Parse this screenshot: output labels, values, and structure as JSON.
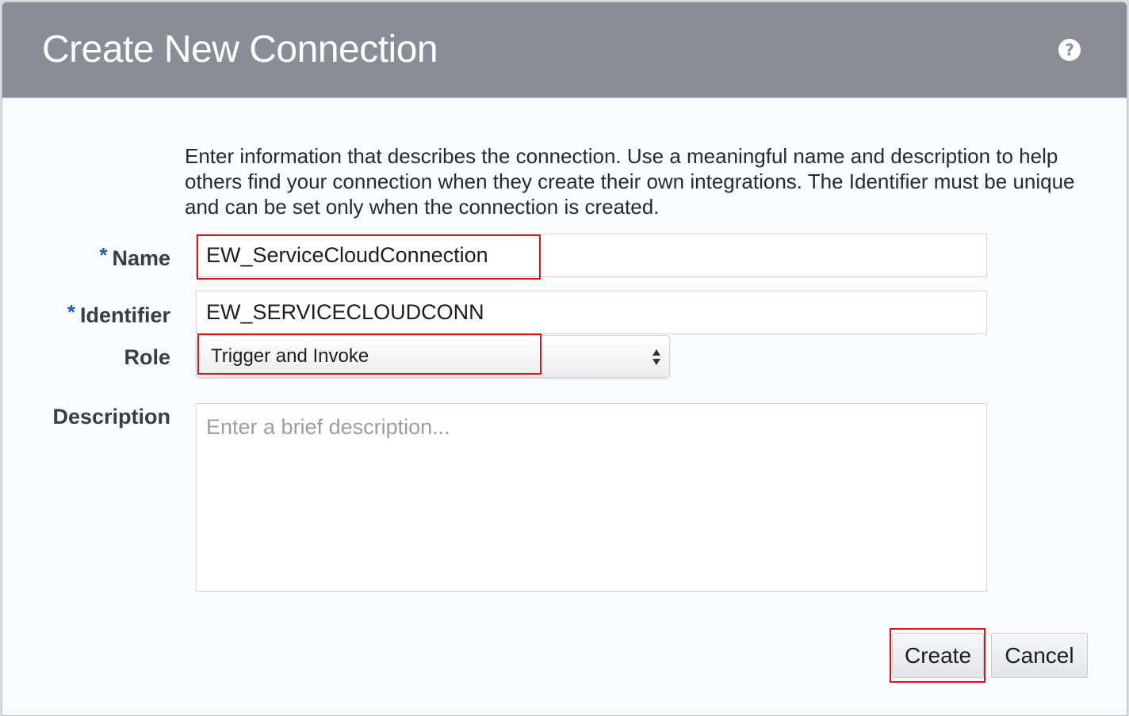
{
  "dialog": {
    "title": "Create New Connection",
    "help_icon": "help-icon"
  },
  "intro_text": "Enter information that describes the connection. Use a meaningful name and description to help others find your connection when they create their own integrations. The Identifier must be unique and can be set only when the connection is created.",
  "form": {
    "required_marker": "*",
    "name": {
      "label": "Name",
      "value": "EW_ServiceCloudConnection",
      "required": true
    },
    "identifier": {
      "label": "Identifier",
      "value": "EW_SERVICECLOUDCONN",
      "required": true
    },
    "role": {
      "label": "Role",
      "selected": "Trigger and Invoke"
    },
    "description": {
      "label": "Description",
      "value": "",
      "placeholder": "Enter a brief description..."
    }
  },
  "buttons": {
    "create_label": "Create",
    "cancel_label": "Cancel"
  },
  "colors": {
    "titlebar": "#8a8d96",
    "highlight": "#d9141b",
    "required_marker": "#1f5fa8"
  }
}
